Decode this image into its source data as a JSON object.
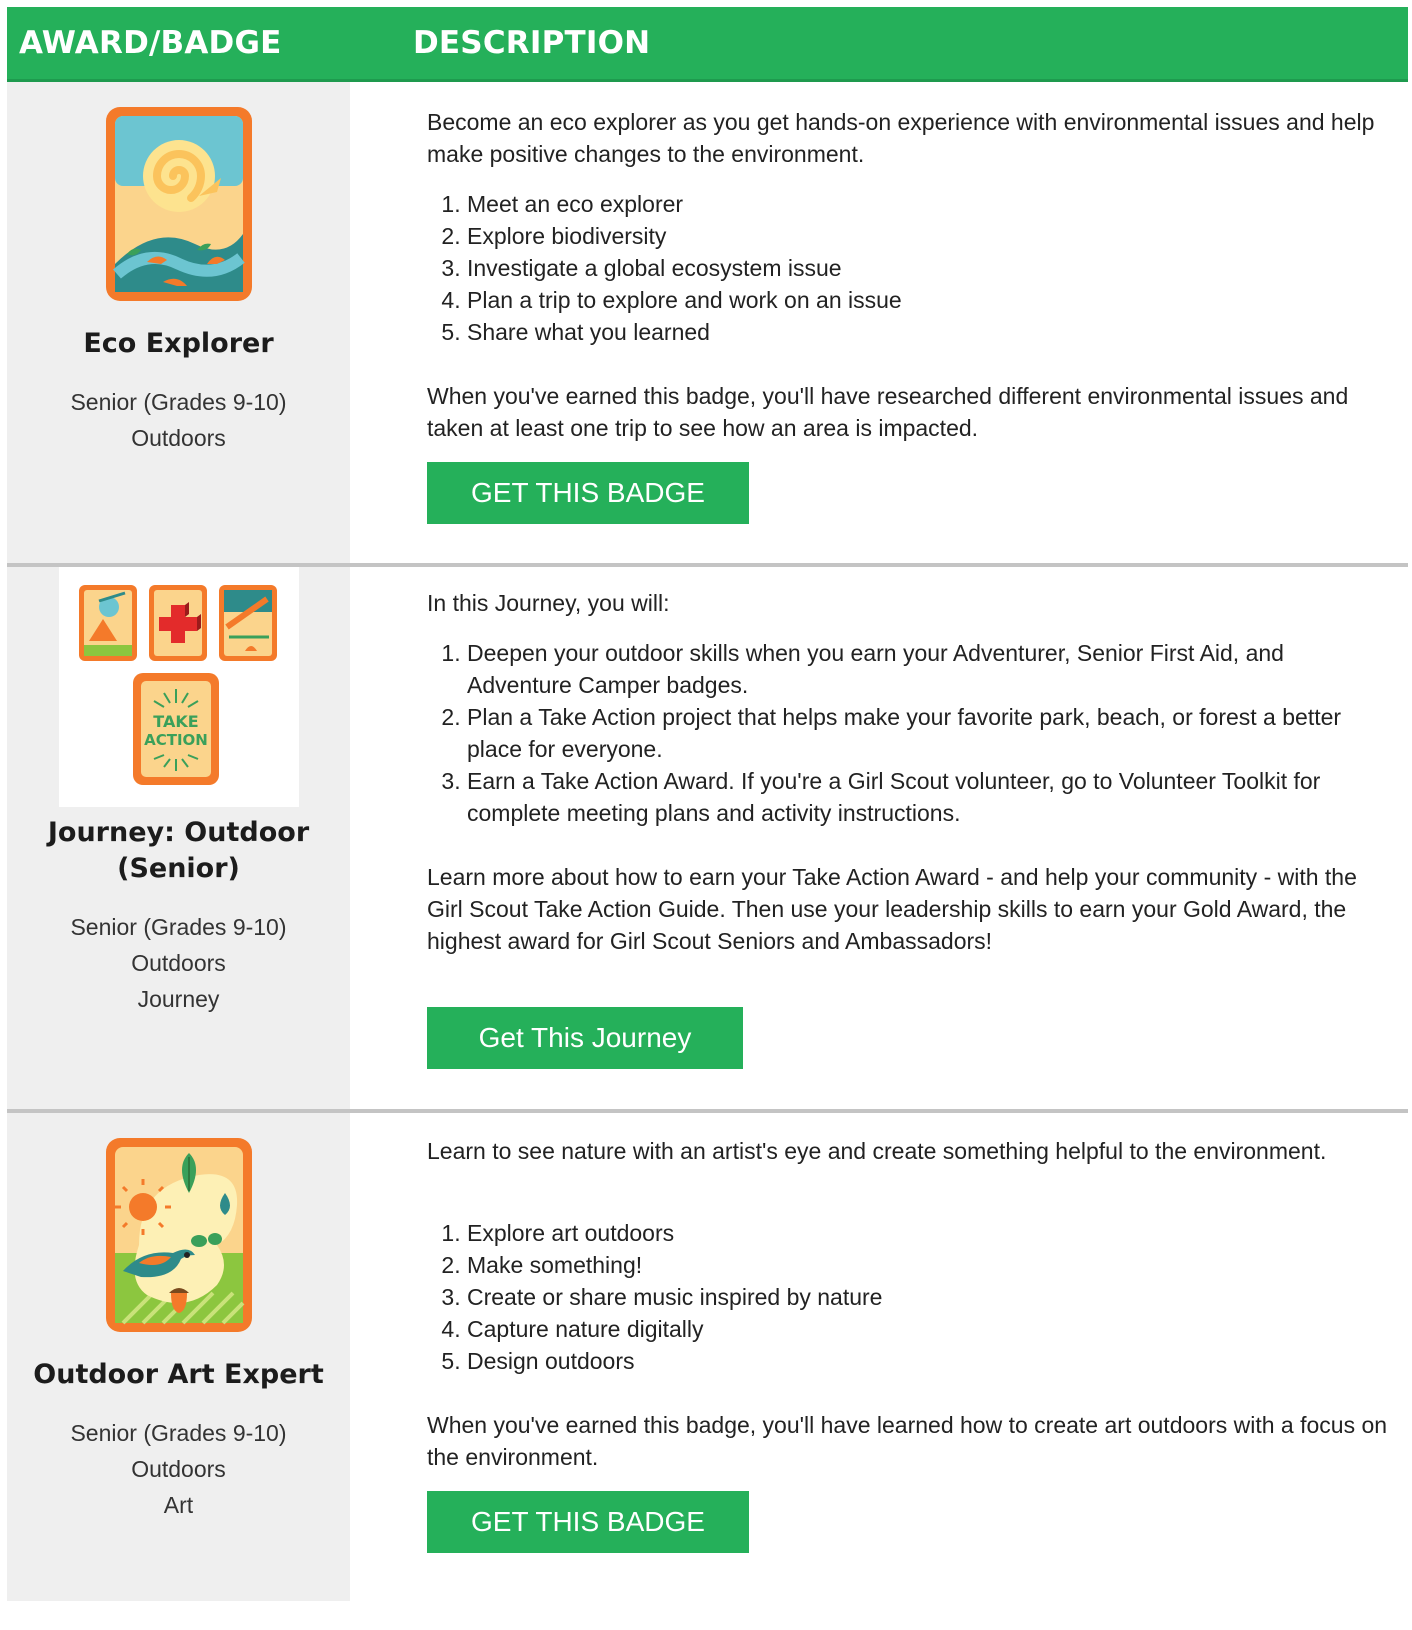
{
  "header": {
    "col_award": "AWARD/BADGE",
    "col_description": "DESCRIPTION"
  },
  "rows": [
    {
      "name": "Eco Explorer",
      "meta": [
        "Senior (Grades 9-10)",
        "Outdoors"
      ],
      "intro": "Become an eco explorer as you get hands-on experience with environmental issues and help make positive changes to the environment.",
      "steps": [
        "Meet an eco explorer",
        "Explore biodiversity",
        "Investigate a global ecosystem issue",
        "Plan a trip to explore and work on an issue",
        "Share what you learned"
      ],
      "outro": "When you've earned this badge, you'll have researched different environmental issues and taken at least one trip to see how an area is impacted.",
      "button": "GET THIS BADGE"
    },
    {
      "name": "Journey: Outdoor (Senior)",
      "meta": [
        "Senior (Grades 9-10)",
        "Outdoors",
        "Journey"
      ],
      "intro": "In this Journey, you will:",
      "steps": [
        "Deepen your outdoor skills when you earn your Adventurer, Senior First Aid, and Adventure Camper badges.",
        "Plan a Take Action project that helps make your favorite park, beach, or forest a better place for everyone.",
        "Earn a Take Action Award. If you're a Girl Scout volunteer, go to Volunteer Toolkit for complete meeting plans and activity instructions."
      ],
      "outro": "Learn more about how to earn your Take Action Award - and help your community - with the Girl Scout Take Action Guide. Then use your leadership skills to earn your Gold Award, the highest award for Girl Scout Seniors and Ambassadors!",
      "badge_text": [
        "TAKE",
        "ACTION"
      ],
      "button": "Get This Journey"
    },
    {
      "name": "Outdoor Art Expert",
      "meta": [
        "Senior (Grades 9-10)",
        "Outdoors",
        "Art"
      ],
      "intro": "Learn to see nature with an artist's eye and create something helpful to the environment.",
      "steps": [
        "Explore art outdoors",
        "Make something!",
        "Create or share music inspired by nature",
        "Capture nature digitally",
        "Design outdoors"
      ],
      "outro": "When you've earned this badge, you'll have learned how to create art outdoors with a focus on the environment.",
      "button": "GET THIS BADGE"
    }
  ],
  "colors": {
    "green": "#25b05a",
    "orange": "#f47a2a",
    "panel_gray": "#efefef"
  }
}
